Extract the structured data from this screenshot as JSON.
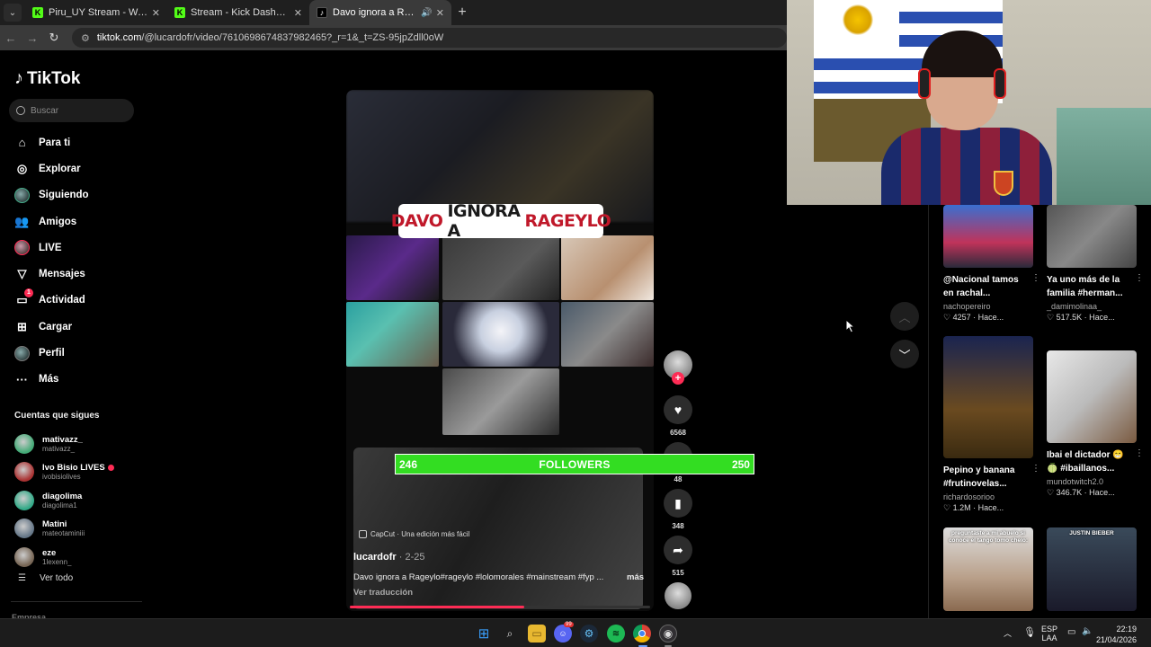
{
  "browser": {
    "tabs": [
      {
        "title": "Piru_UY Stream - Watch Live on",
        "fav": "K",
        "kind": "kick",
        "close": "✕"
      },
      {
        "title": "Stream - Kick Dashboard",
        "fav": "K",
        "kind": "kick",
        "close": "✕"
      },
      {
        "title": "Davo ignora a Rageylo: ¿Pre",
        "fav": "♪",
        "kind": "tt",
        "close": "✕",
        "active": true
      }
    ],
    "new_tab": "+",
    "url_domain": "tiktok.com",
    "url_path": "/@lucardofr/video/7610698674837982465?_r=1&_t=ZS-95jpZdll0oW"
  },
  "sidebar": {
    "logo": "TikTok",
    "search_placeholder": "Buscar",
    "nav": [
      {
        "label": "Para ti",
        "icon": "home-icon",
        "glyph": "⌂"
      },
      {
        "label": "Explorar",
        "icon": "compass-icon",
        "glyph": "◎"
      },
      {
        "label": "Siguiendo",
        "icon": "following-avatar-icon",
        "glyph": ""
      },
      {
        "label": "Amigos",
        "icon": "friends-icon",
        "glyph": "👥"
      },
      {
        "label": "LIVE",
        "icon": "live-avatar-icon",
        "glyph": ""
      },
      {
        "label": "Mensajes",
        "icon": "send-icon",
        "glyph": "▽"
      },
      {
        "label": "Actividad",
        "icon": "activity-icon",
        "glyph": "▭",
        "badge": "1"
      },
      {
        "label": "Cargar",
        "icon": "upload-icon",
        "glyph": "⊞"
      },
      {
        "label": "Perfil",
        "icon": "profile-avatar-icon",
        "glyph": ""
      },
      {
        "label": "Más",
        "icon": "more-icon",
        "glyph": "···"
      }
    ],
    "following_header": "Cuentas que sigues",
    "following": [
      {
        "name": "mativazz_",
        "handle": "mativazz_",
        "live": false,
        "color": "#4a7"
      },
      {
        "name": "Ivo Bisio LIVES",
        "handle": "ivobisiolives",
        "live": true,
        "color": "#a33"
      },
      {
        "name": "diagolima",
        "handle": "diagolima1",
        "live": false,
        "color": "#3a8"
      },
      {
        "name": "Matini",
        "handle": "mateotaminiii",
        "live": false,
        "color": "#678"
      },
      {
        "name": "eze",
        "handle": "1lexenn_",
        "live": false,
        "color": "#765"
      }
    ],
    "see_all": "Ver todo",
    "company": "Empresa"
  },
  "video": {
    "title_parts": [
      "DAVO",
      "IGNORA A",
      "RAGEYLO"
    ],
    "capcut": "CapCut · Una edición más fácil",
    "author": "lucardofr",
    "date": " · 2-25",
    "description": "Davo ignora a Rageylo#rageylo #lolomorales #mainstream #fyp ...",
    "more": "más",
    "translate": "Ver traducción",
    "progress": 0.58
  },
  "actions": {
    "likes": "6568",
    "comments": "48",
    "saves": "348",
    "shares": "515"
  },
  "followers_goal": {
    "current": "246",
    "label": "FOLLOWERS",
    "target": "250",
    "color": "#33dd22"
  },
  "recommended": [
    {
      "title": "@Nacional tamos en rachal...",
      "author": "nachopereiro",
      "stats": "♡ 4257 · Hace...",
      "bg": "linear-gradient(180deg,#3a6fd0 0%,#c0335a 60%,#2a2a3a 100%)"
    },
    {
      "title": "Ya uno más de la familia #herman...",
      "author": "_damimolinaa_",
      "stats": "♡ 517.5K · Hace...",
      "bg": "linear-gradient(135deg,#555 0%,#888 50%,#444 100%)"
    },
    {
      "title": "Pepino y banana #frutinovelas...",
      "author": "richardosorioo",
      "stats": "♡ 1.2M · Hace...",
      "bg": "linear-gradient(180deg,#1a2450 0%,#6a4a20 60%,#3a2a10 100%)"
    },
    {
      "title": "Ibai el dictador 😁 🍈 #ibaillanos...",
      "author": "mundotwitch2.0",
      "stats": "♡ 346.7K · Hace...",
      "bg": "linear-gradient(135deg,#e8e8e8 0%,#bbb 50%,#7a5a40 100%)"
    },
    {
      "title": "",
      "author": "",
      "stats": "",
      "caption": "preguntaste a mi abuelo si conoce el tango tomo chelo:",
      "bg": "linear-gradient(180deg,#ddd 0%,#b9a08a 60%,#8a6a50 100%)"
    },
    {
      "title": "",
      "author": "",
      "stats": "",
      "caption": "JUSTIN BIEBER",
      "bg": "linear-gradient(180deg,#3a4a5a 0%,#1a1a2a 100%)"
    }
  ],
  "taskbar": {
    "icons": [
      "windows-start-icon",
      "search-icon",
      "file-explorer-icon",
      "discord-icon",
      "steam-icon",
      "spotify-icon",
      "chrome-icon",
      "obs-icon"
    ],
    "discord_badge": "99",
    "lang1": "ESP",
    "lang2": "LAA",
    "time": "22:19",
    "date": "21/04/2026"
  }
}
